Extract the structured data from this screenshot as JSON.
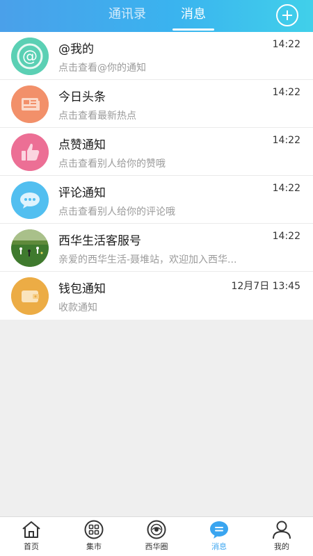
{
  "header": {
    "tabs": [
      {
        "label": "通讯录"
      },
      {
        "label": "消息"
      }
    ]
  },
  "messages": [
    {
      "title": "@我的",
      "subtitle": "点击查看@你的通知",
      "time": "14:22",
      "icon": "at-icon",
      "color": "#5bd0b4"
    },
    {
      "title": "今日头条",
      "subtitle": "点击查看最新热点",
      "time": "14:22",
      "icon": "newspaper-icon",
      "color": "#f2906a"
    },
    {
      "title": "点赞通知",
      "subtitle": "点击查看别人给你的赞哦",
      "time": "14:22",
      "icon": "thumbs-up-icon",
      "color": "#ec6f95"
    },
    {
      "title": "评论通知",
      "subtitle": "点击查看别人给你的评论哦",
      "time": "14:22",
      "icon": "comment-icon",
      "color": "#52bff0"
    },
    {
      "title": "西华生活客服号",
      "subtitle": "亲爱的西华生活-聂堆站，欢迎加入西华...",
      "time": "14:22",
      "icon": "photo-avatar",
      "color": "#4d8a3d"
    },
    {
      "title": "钱包通知",
      "subtitle": "收款通知",
      "time": "12月7日 13:45",
      "icon": "wallet-icon",
      "color": "#ecac45"
    }
  ],
  "tabbar": {
    "items": [
      {
        "label": "首页",
        "icon": "home-icon"
      },
      {
        "label": "集市",
        "icon": "market-icon"
      },
      {
        "label": "西华圈",
        "icon": "moments-icon"
      },
      {
        "label": "消息",
        "icon": "message-icon"
      },
      {
        "label": "我的",
        "icon": "user-icon"
      }
    ],
    "active_color": "#3aa5f0"
  }
}
